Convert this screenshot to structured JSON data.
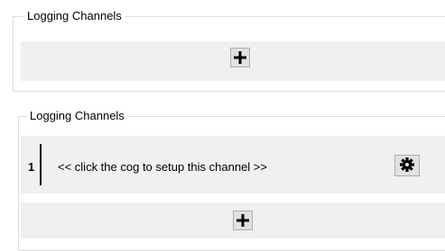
{
  "groups": [
    {
      "title": "Logging Channels",
      "add_icon": "plus-icon"
    },
    {
      "title": "Logging Channels",
      "channels": [
        {
          "number": "1",
          "text": "<< click the cog to setup this channel >>",
          "settings_icon": "gear-icon"
        }
      ],
      "add_icon": "plus-icon"
    }
  ]
}
